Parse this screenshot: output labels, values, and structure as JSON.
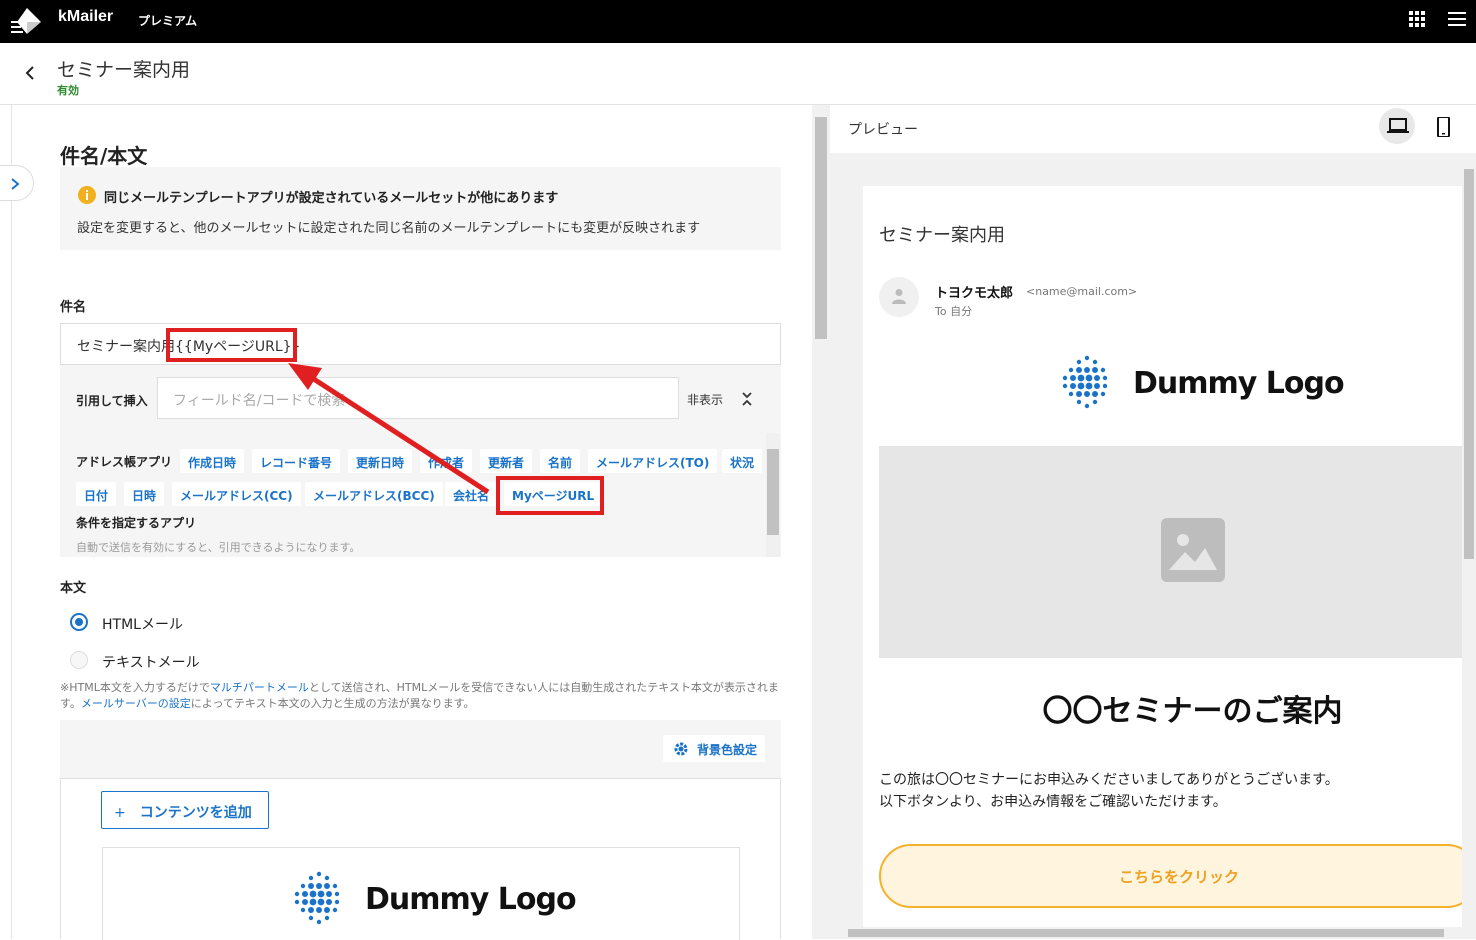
{
  "topbar": {
    "app_name": "kMailer",
    "plan": "プレミアム"
  },
  "header": {
    "title": "セミナー案内用",
    "status": "有効"
  },
  "editor": {
    "section_title": "件名/本文",
    "notice": {
      "title": "同じメールテンプレートアプリが設定されているメールセットが他にあります",
      "desc": "設定を変更すると、他のメールセットに設定された同じ名前のメールテンプレートにも変更が反映されます"
    },
    "subject_label": "件名",
    "subject_value": "セミナー案内用{{MyページURL}}",
    "insert": {
      "label": "引用して挿入",
      "search_placeholder": "フィールド名/コードで検索",
      "hide_label": "非表示"
    },
    "field_groups": {
      "address_book": "アドレス帳アプリ",
      "conditional": "条件を指定するアプリ",
      "conditional_hint": "自動で送信を有効にすると、引用できるようになります。"
    },
    "chips": [
      "作成日時",
      "レコード番号",
      "更新日時",
      "作成者",
      "更新者",
      "名前",
      "メールアドレス(TO)",
      "状況",
      "日付",
      "日時",
      "メールアドレス(CC)",
      "メールアドレス(BCC)",
      "会社名",
      "MyページURL"
    ],
    "body_label": "本文",
    "body_options": {
      "html": "HTMLメール",
      "text": "テキストメール",
      "selected": "HTMLメール"
    },
    "note": {
      "p1": "※HTML本文を入力するだけで",
      "link1": "マルチパートメール",
      "p2": "として送信され、HTMLメールを受信できない人には自動生成されたテキスト本文が表示されます。",
      "link2": "メールサーバーの設定",
      "p3": "によってテキスト本文の入力と生成の方法が異なります。"
    },
    "bg_color_button": "背景色設定",
    "add_content_button": "コンテンツを追加",
    "logo_text": "Dummy Logo"
  },
  "preview": {
    "title": "プレビュー",
    "mail": {
      "subject": "セミナー案内用",
      "sender_name": "トヨクモ太郎",
      "sender_email": "<name@mail.com>",
      "to": "To 自分",
      "logo_text": "Dummy Logo",
      "headline": "〇〇セミナーのご案内",
      "body_line1": "この旅は〇〇セミナーにお申込みくださいましてありがとうございます。",
      "body_line2": "以下ボタンより、お申込み情報をご確認いただけます。",
      "cta": "こちらをクリック"
    }
  },
  "colors": {
    "accent": "#1a73c9",
    "highlight": "#e02020",
    "cta_border": "#f5b12b",
    "status": "#2e8b2e"
  }
}
